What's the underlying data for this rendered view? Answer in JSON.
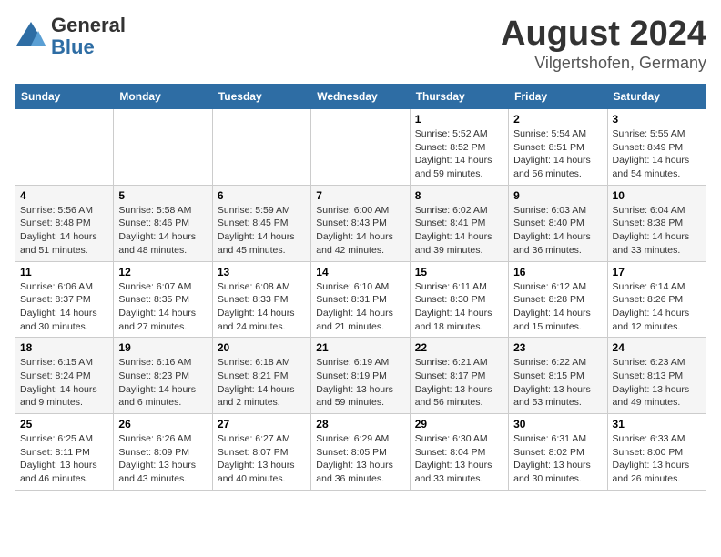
{
  "header": {
    "logo_line1": "General",
    "logo_line2": "Blue",
    "title": "August 2024",
    "subtitle": "Vilgertshofen, Germany"
  },
  "calendar": {
    "days_of_week": [
      "Sunday",
      "Monday",
      "Tuesday",
      "Wednesday",
      "Thursday",
      "Friday",
      "Saturday"
    ],
    "weeks": [
      [
        {
          "day": "",
          "content": ""
        },
        {
          "day": "",
          "content": ""
        },
        {
          "day": "",
          "content": ""
        },
        {
          "day": "",
          "content": ""
        },
        {
          "day": "1",
          "content": "Sunrise: 5:52 AM\nSunset: 8:52 PM\nDaylight: 14 hours and 59 minutes."
        },
        {
          "day": "2",
          "content": "Sunrise: 5:54 AM\nSunset: 8:51 PM\nDaylight: 14 hours and 56 minutes."
        },
        {
          "day": "3",
          "content": "Sunrise: 5:55 AM\nSunset: 8:49 PM\nDaylight: 14 hours and 54 minutes."
        }
      ],
      [
        {
          "day": "4",
          "content": "Sunrise: 5:56 AM\nSunset: 8:48 PM\nDaylight: 14 hours and 51 minutes."
        },
        {
          "day": "5",
          "content": "Sunrise: 5:58 AM\nSunset: 8:46 PM\nDaylight: 14 hours and 48 minutes."
        },
        {
          "day": "6",
          "content": "Sunrise: 5:59 AM\nSunset: 8:45 PM\nDaylight: 14 hours and 45 minutes."
        },
        {
          "day": "7",
          "content": "Sunrise: 6:00 AM\nSunset: 8:43 PM\nDaylight: 14 hours and 42 minutes."
        },
        {
          "day": "8",
          "content": "Sunrise: 6:02 AM\nSunset: 8:41 PM\nDaylight: 14 hours and 39 minutes."
        },
        {
          "day": "9",
          "content": "Sunrise: 6:03 AM\nSunset: 8:40 PM\nDaylight: 14 hours and 36 minutes."
        },
        {
          "day": "10",
          "content": "Sunrise: 6:04 AM\nSunset: 8:38 PM\nDaylight: 14 hours and 33 minutes."
        }
      ],
      [
        {
          "day": "11",
          "content": "Sunrise: 6:06 AM\nSunset: 8:37 PM\nDaylight: 14 hours and 30 minutes."
        },
        {
          "day": "12",
          "content": "Sunrise: 6:07 AM\nSunset: 8:35 PM\nDaylight: 14 hours and 27 minutes."
        },
        {
          "day": "13",
          "content": "Sunrise: 6:08 AM\nSunset: 8:33 PM\nDaylight: 14 hours and 24 minutes."
        },
        {
          "day": "14",
          "content": "Sunrise: 6:10 AM\nSunset: 8:31 PM\nDaylight: 14 hours and 21 minutes."
        },
        {
          "day": "15",
          "content": "Sunrise: 6:11 AM\nSunset: 8:30 PM\nDaylight: 14 hours and 18 minutes."
        },
        {
          "day": "16",
          "content": "Sunrise: 6:12 AM\nSunset: 8:28 PM\nDaylight: 14 hours and 15 minutes."
        },
        {
          "day": "17",
          "content": "Sunrise: 6:14 AM\nSunset: 8:26 PM\nDaylight: 14 hours and 12 minutes."
        }
      ],
      [
        {
          "day": "18",
          "content": "Sunrise: 6:15 AM\nSunset: 8:24 PM\nDaylight: 14 hours and 9 minutes."
        },
        {
          "day": "19",
          "content": "Sunrise: 6:16 AM\nSunset: 8:23 PM\nDaylight: 14 hours and 6 minutes."
        },
        {
          "day": "20",
          "content": "Sunrise: 6:18 AM\nSunset: 8:21 PM\nDaylight: 14 hours and 2 minutes."
        },
        {
          "day": "21",
          "content": "Sunrise: 6:19 AM\nSunset: 8:19 PM\nDaylight: 13 hours and 59 minutes."
        },
        {
          "day": "22",
          "content": "Sunrise: 6:21 AM\nSunset: 8:17 PM\nDaylight: 13 hours and 56 minutes."
        },
        {
          "day": "23",
          "content": "Sunrise: 6:22 AM\nSunset: 8:15 PM\nDaylight: 13 hours and 53 minutes."
        },
        {
          "day": "24",
          "content": "Sunrise: 6:23 AM\nSunset: 8:13 PM\nDaylight: 13 hours and 49 minutes."
        }
      ],
      [
        {
          "day": "25",
          "content": "Sunrise: 6:25 AM\nSunset: 8:11 PM\nDaylight: 13 hours and 46 minutes."
        },
        {
          "day": "26",
          "content": "Sunrise: 6:26 AM\nSunset: 8:09 PM\nDaylight: 13 hours and 43 minutes."
        },
        {
          "day": "27",
          "content": "Sunrise: 6:27 AM\nSunset: 8:07 PM\nDaylight: 13 hours and 40 minutes."
        },
        {
          "day": "28",
          "content": "Sunrise: 6:29 AM\nSunset: 8:05 PM\nDaylight: 13 hours and 36 minutes."
        },
        {
          "day": "29",
          "content": "Sunrise: 6:30 AM\nSunset: 8:04 PM\nDaylight: 13 hours and 33 minutes."
        },
        {
          "day": "30",
          "content": "Sunrise: 6:31 AM\nSunset: 8:02 PM\nDaylight: 13 hours and 30 minutes."
        },
        {
          "day": "31",
          "content": "Sunrise: 6:33 AM\nSunset: 8:00 PM\nDaylight: 13 hours and 26 minutes."
        }
      ]
    ]
  }
}
